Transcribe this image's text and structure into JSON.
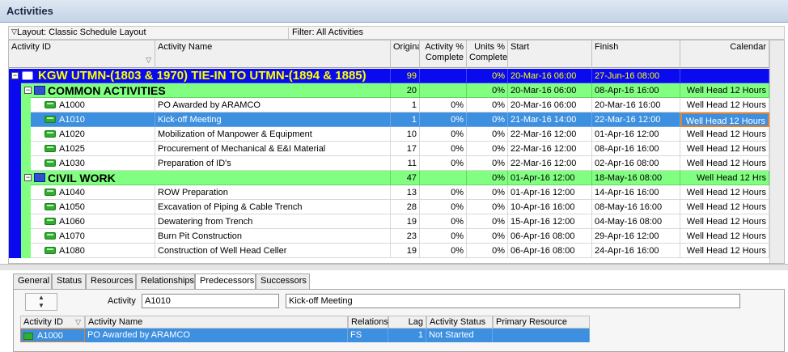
{
  "window": {
    "title": "Activities"
  },
  "layout_bar": {
    "layout": "Layout: Classic Schedule Layout",
    "filter": "Filter: All Activities"
  },
  "columns": {
    "id": "Activity ID",
    "name": "Activity Name",
    "orig": "Original",
    "act_pct_1": "Activity %",
    "act_pct_2": "Complete",
    "units_pct_1": "Units %",
    "units_pct_2": "Complete",
    "start": "Start",
    "finish": "Finish",
    "calendar": "Calendar"
  },
  "rows": [
    {
      "type": "proj",
      "id": "",
      "name": "KGW UTMN-(1803 & 1970) TIE-IN TO UTMN-(1894 & 1885)",
      "orig": "99",
      "act": "",
      "units": "0%",
      "start": "20-Mar-16 06:00",
      "finish": "27-Jun-16 08:00",
      "cal": ""
    },
    {
      "type": "wbs",
      "id": "",
      "name": "COMMON ACTIVITIES",
      "orig": "20",
      "act": "",
      "units": "0%",
      "start": "20-Mar-16 06:00",
      "finish": "08-Apr-16 16:00",
      "cal": "Well Head 12 Hours"
    },
    {
      "type": "task",
      "id": "A1000",
      "name": "PO Awarded by ARAMCO",
      "orig": "1",
      "act": "0%",
      "units": "0%",
      "start": "20-Mar-16 06:00",
      "finish": "20-Mar-16 16:00",
      "cal": "Well Head 12 Hours"
    },
    {
      "type": "sel",
      "id": "A1010",
      "name": "Kick-off Meeting",
      "orig": "1",
      "act": "0%",
      "units": "0%",
      "start": "21-Mar-16 14:00",
      "finish": "22-Mar-16 12:00",
      "cal": "Well Head 12 Hours"
    },
    {
      "type": "task",
      "id": "A1020",
      "name": "Mobilization of Manpower & Equipment",
      "orig": "10",
      "act": "0%",
      "units": "0%",
      "start": "22-Mar-16 12:00",
      "finish": "01-Apr-16 12:00",
      "cal": "Well Head 12 Hours"
    },
    {
      "type": "task",
      "id": "A1025",
      "name": "Procurement of Mechanical & E&I Material",
      "orig": "17",
      "act": "0%",
      "units": "0%",
      "start": "22-Mar-16 12:00",
      "finish": "08-Apr-16 16:00",
      "cal": "Well Head 12 Hours"
    },
    {
      "type": "task",
      "id": "A1030",
      "name": "Preparation of ID's",
      "orig": "11",
      "act": "0%",
      "units": "0%",
      "start": "22-Mar-16 12:00",
      "finish": "02-Apr-16 08:00",
      "cal": "Well Head 12 Hours"
    },
    {
      "type": "wbs",
      "id": "",
      "name": "CIVIL WORK",
      "orig": "47",
      "act": "",
      "units": "0%",
      "start": "01-Apr-16 12:00",
      "finish": "18-May-16 08:00",
      "cal": "Well Head 12 Hrs"
    },
    {
      "type": "task",
      "id": "A1040",
      "name": "ROW Preparation",
      "orig": "13",
      "act": "0%",
      "units": "0%",
      "start": "01-Apr-16 12:00",
      "finish": "14-Apr-16 16:00",
      "cal": "Well Head 12 Hours"
    },
    {
      "type": "task",
      "id": "A1050",
      "name": "Excavation of Piping & Cable Trench",
      "orig": "28",
      "act": "0%",
      "units": "0%",
      "start": "10-Apr-16 16:00",
      "finish": "08-May-16 16:00",
      "cal": "Well Head 12 Hours"
    },
    {
      "type": "task",
      "id": "A1060",
      "name": "Dewatering from Trench",
      "orig": "19",
      "act": "0%",
      "units": "0%",
      "start": "15-Apr-16 12:00",
      "finish": "04-May-16 08:00",
      "cal": "Well Head 12 Hours"
    },
    {
      "type": "task",
      "id": "A1070",
      "name": "Burn Pit Construction",
      "orig": "23",
      "act": "0%",
      "units": "0%",
      "start": "06-Apr-16 08:00",
      "finish": "29-Apr-16 12:00",
      "cal": "Well Head 12 Hours"
    },
    {
      "type": "task",
      "id": "A1080",
      "name": "Construction of Well Head Celler",
      "orig": "19",
      "act": "0%",
      "units": "0%",
      "start": "06-Apr-16 08:00",
      "finish": "24-Apr-16 16:00",
      "cal": "Well Head 12 Hours"
    }
  ],
  "tabs": [
    "General",
    "Status",
    "Resources",
    "Relationships",
    "Predecessors",
    "Successors"
  ],
  "active_tab": "Predecessors",
  "detail": {
    "activity_label": "Activity",
    "activity_id": "A1010",
    "activity_name": "Kick-off Meeting"
  },
  "pred_columns": {
    "id": "Activity ID",
    "name": "Activity Name",
    "rel": "Relations",
    "lag": "Lag",
    "status": "Activity Status",
    "res": "Primary Resource"
  },
  "pred_rows": [
    {
      "id": "A1000",
      "name": "PO Awarded by ARAMCO",
      "rel": "FS",
      "lag": "1",
      "status": "Not Started",
      "res": ""
    }
  ]
}
